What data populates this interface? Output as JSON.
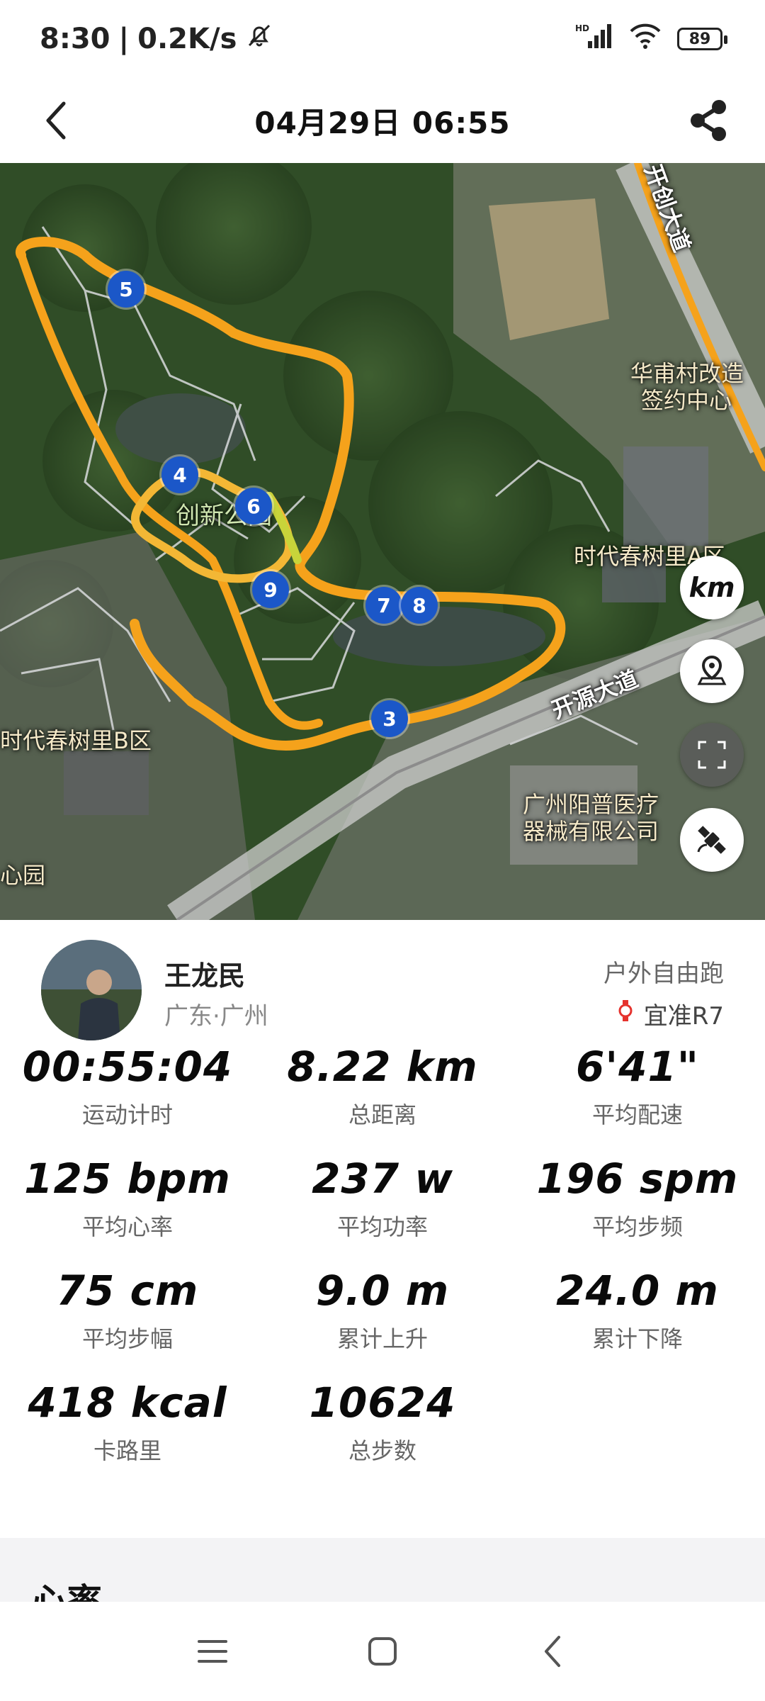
{
  "status_bar": {
    "time": "8:30",
    "speed": "0.2K/s",
    "battery": "89",
    "network_badge": "HD"
  },
  "header": {
    "title": "04月29日 06:55"
  },
  "map": {
    "labels": [
      {
        "text": "创新公园",
        "kind": "park"
      },
      {
        "text": "时代春树里A区",
        "kind": "area"
      },
      {
        "text": "时代春树里B区",
        "kind": "area"
      },
      {
        "text": "华甫村改造",
        "kind": "poi"
      },
      {
        "text": "签约中心",
        "kind": "poi"
      },
      {
        "text": "开源大道",
        "kind": "road"
      },
      {
        "text": "开创大道",
        "kind": "road"
      },
      {
        "text": "广州阳普医疗",
        "kind": "poi"
      },
      {
        "text": "器械有限公司",
        "kind": "poi"
      },
      {
        "text": "心园",
        "kind": "area"
      }
    ],
    "markers": [
      "3",
      "4",
      "5",
      "6",
      "7",
      "8",
      "9"
    ],
    "unit_button": "km",
    "route_color": "#f5a21b",
    "marker_color": "#1b57c8"
  },
  "profile": {
    "name": "王龙民",
    "location": "广东·广州",
    "activity_type": "户外自由跑",
    "device": "宜准R7"
  },
  "stats": [
    {
      "value": "00:55:04",
      "label": "运动计时"
    },
    {
      "value": "8.22 km",
      "label": "总距离"
    },
    {
      "value": "6'41\"",
      "label": "平均配速"
    },
    {
      "value": "125 bpm",
      "label": "平均心率"
    },
    {
      "value": "237 w",
      "label": "平均功率"
    },
    {
      "value": "196 spm",
      "label": "平均步频"
    },
    {
      "value": "75 cm",
      "label": "平均步幅"
    },
    {
      "value": "9.0 m",
      "label": "累计上升"
    },
    {
      "value": "24.0 m",
      "label": "累计下降"
    },
    {
      "value": "418 kcal",
      "label": "卡路里"
    },
    {
      "value": "10624",
      "label": "总步数"
    }
  ],
  "section": {
    "title": "心率"
  }
}
